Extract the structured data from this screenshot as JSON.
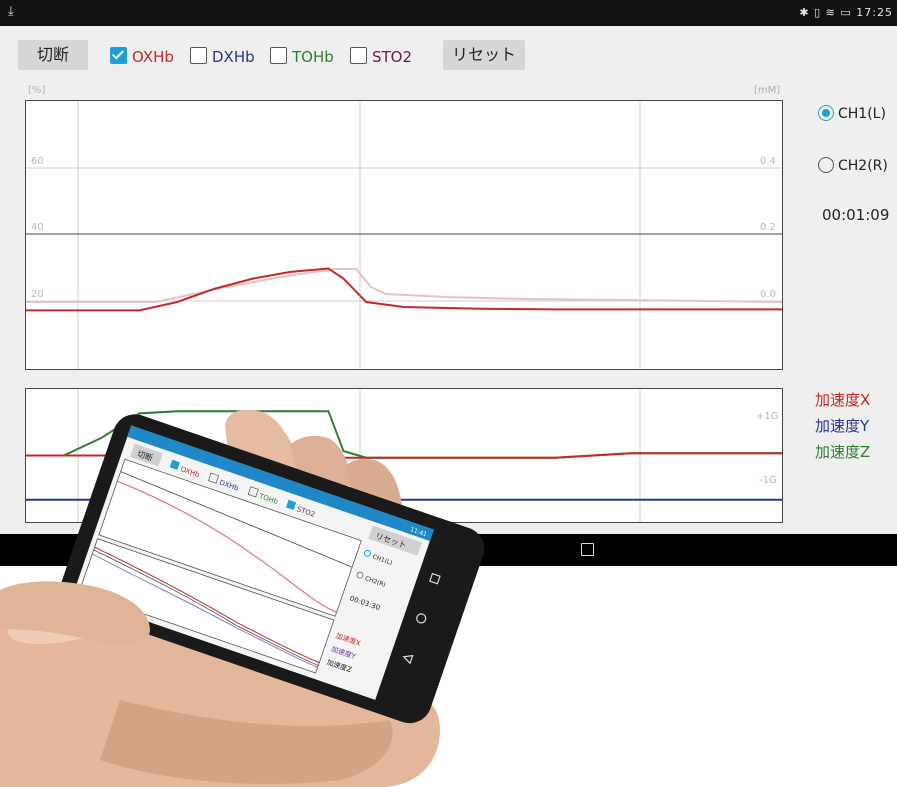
{
  "status_bar": {
    "left_icon": "download-icon",
    "right_text": "✱ ▯ ≋ ▭ 17:25"
  },
  "toolbar": {
    "disconnect_label": "切断",
    "reset_label": "リセット",
    "checkboxes": [
      {
        "label": "OXHb",
        "checked": true,
        "color": "#c62828"
      },
      {
        "label": "DXHb",
        "checked": false,
        "color": "#283593"
      },
      {
        "label": "TOHb",
        "checked": false,
        "color": "#2e7d32"
      },
      {
        "label": "STO2",
        "checked": false,
        "color": "#6a1b4d"
      }
    ]
  },
  "upper_chart": {
    "left_unit": "[%]",
    "right_unit": "[mM]",
    "left_ticks": [
      "60",
      "40",
      "20"
    ],
    "right_ticks": [
      "0.4",
      "0.2",
      "0.0"
    ]
  },
  "lower_chart": {
    "right_ticks": [
      "+1G",
      "-1G"
    ]
  },
  "side_panel": {
    "channels": [
      {
        "label": "CH1(L)",
        "selected": true
      },
      {
        "label": "CH2(R)",
        "selected": false
      }
    ],
    "timer": "00:01:09",
    "accel_labels": [
      {
        "label": "加速度X",
        "color": "#c62828"
      },
      {
        "label": "加速度Y",
        "color": "#283593"
      },
      {
        "label": "加速度Z",
        "color": "#2e7d32"
      }
    ]
  },
  "phone": {
    "disconnect_label": "切断",
    "reset_label": "リセット",
    "checkboxes": [
      "OXHb",
      "DXHb",
      "TOHb",
      "STO2"
    ],
    "status_time": "11:41",
    "channels": [
      "CH1(L)",
      "CH2(R)"
    ],
    "timer": "00:03:30",
    "accel_labels": [
      "加速度X",
      "加速度Y",
      "加速度Z"
    ]
  },
  "chart_data": [
    {
      "type": "line",
      "title": "",
      "ylabel": "[%]",
      "y2label": "[mM]",
      "ylim": [
        0,
        80
      ],
      "x": [
        0,
        5,
        10,
        15,
        20,
        25,
        30,
        35,
        40,
        42,
        45,
        50,
        60,
        70,
        80,
        90,
        100
      ],
      "series": [
        {
          "name": "OXHb",
          "values": [
            17.5,
            17.5,
            17.5,
            17.5,
            20,
            24,
            27,
            29,
            30,
            27,
            20,
            18.5,
            18,
            17.8,
            17.8,
            17.8,
            17.8
          ]
        }
      ],
      "grid": true
    },
    {
      "type": "line",
      "title": "",
      "ylim": [
        -1.5,
        1.5
      ],
      "x": [
        0,
        5,
        10,
        15,
        20,
        25,
        30,
        35,
        40,
        42,
        45,
        50,
        60,
        70,
        80,
        90,
        100
      ],
      "series": [
        {
          "name": "加速度X",
          "values": [
            0,
            0,
            0,
            0,
            0,
            0,
            0,
            0,
            0,
            -0.05,
            -0.05,
            -0.05,
            -0.05,
            -0.05,
            0.05,
            0.05,
            0.05
          ]
        },
        {
          "name": "加速度Y",
          "values": [
            -1,
            -1,
            -1,
            -1,
            -1,
            -1,
            -1,
            -1,
            -1,
            -1,
            -1,
            -1,
            -1,
            -1,
            -1,
            -1,
            -1
          ]
        },
        {
          "name": "加速度Z",
          "values": [
            0,
            0,
            0.4,
            0.95,
            1.0,
            1.0,
            1.0,
            1.0,
            1.0,
            0.1,
            -0.05,
            -0.05,
            -0.05,
            -0.05,
            0.05,
            0.05,
            0.05
          ]
        }
      ],
      "grid": true
    }
  ]
}
